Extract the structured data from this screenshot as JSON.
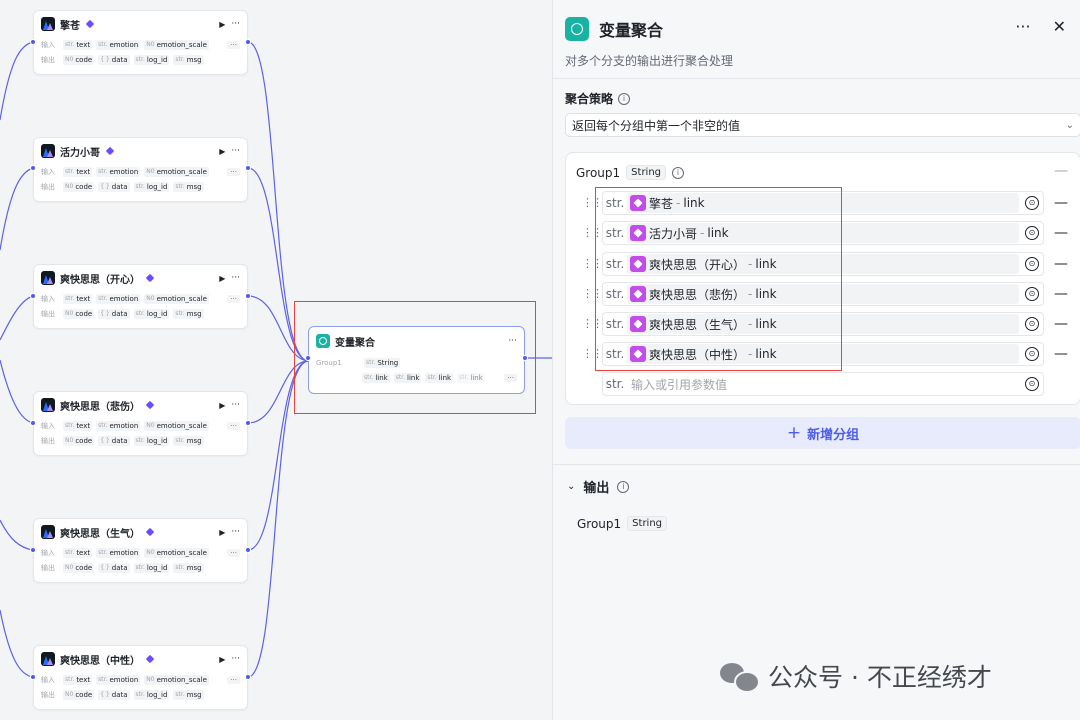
{
  "canvas": {
    "nodes": [
      {
        "title": "擎苍"
      },
      {
        "title": "活力小哥"
      },
      {
        "title": "爽快思思（开心）"
      },
      {
        "title": "爽快思思（悲伤）"
      },
      {
        "title": "爽快思思（生气）"
      },
      {
        "title": "爽快思思（中性）"
      }
    ],
    "node_common": {
      "input_label": "输入",
      "output_label": "输出",
      "inputs": [
        {
          "type": "str.",
          "name": "text"
        },
        {
          "type": "str.",
          "name": "emotion"
        },
        {
          "type": "N0",
          "name": "emotion_scale"
        }
      ],
      "outputs": [
        {
          "type": "N0",
          "name": "code"
        },
        {
          "type": "{ }",
          "name": "data"
        },
        {
          "type": "str.",
          "name": "log_id"
        },
        {
          "type": "str.",
          "name": "msg"
        }
      ],
      "more": "···"
    },
    "aggregator": {
      "title": "变量聚合",
      "group_label": "Group1",
      "group_type_prefix": "str.",
      "group_type": "String",
      "items": [
        {
          "prefix": "str.",
          "name": "link"
        },
        {
          "prefix": "str.",
          "name": "link"
        },
        {
          "prefix": "str.",
          "name": "link"
        },
        {
          "prefix": "str.",
          "name": "link"
        }
      ],
      "more": "···"
    }
  },
  "panel": {
    "title": "变量聚合",
    "more": "···",
    "close": "✕",
    "description": "对多个分支的输出进行聚合处理",
    "strategy_label": "聚合策略",
    "strategy_value": "返回每个分组中第一个非空的值",
    "group": {
      "name": "Group1",
      "type": "String",
      "items": [
        {
          "prefix": "str.",
          "node": "擎苍",
          "sep": "-",
          "var": "link"
        },
        {
          "prefix": "str.",
          "node": "活力小哥",
          "sep": "-",
          "var": "link"
        },
        {
          "prefix": "str.",
          "node": "爽快思思（开心）",
          "sep": "-",
          "var": "link"
        },
        {
          "prefix": "str.",
          "node": "爽快思思（悲伤）",
          "sep": "-",
          "var": "link"
        },
        {
          "prefix": "str.",
          "node": "爽快思思（生气）",
          "sep": "-",
          "var": "link"
        },
        {
          "prefix": "str.",
          "node": "爽快思思（中性）",
          "sep": "-",
          "var": "link"
        }
      ],
      "empty_prefix": "str.",
      "placeholder": "输入或引用参数值"
    },
    "add_group_label": "新增分组",
    "output_label": "输出",
    "output_var": "Group1",
    "output_type": "String"
  },
  "watermark": "公众号 · 不正经绣才",
  "colors": {
    "accent": "#4e5de8",
    "highlight": "#e8423f",
    "aggregator": "#18b3a3",
    "voice_plugin": "#c24de8"
  }
}
